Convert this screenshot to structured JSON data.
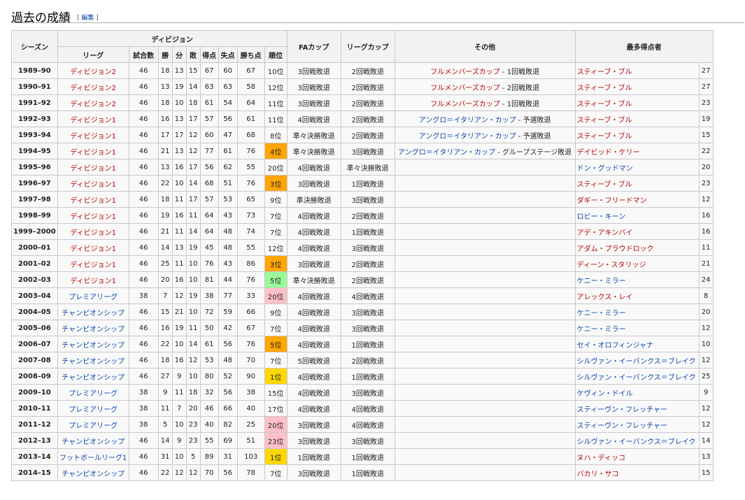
{
  "section": {
    "title": "過去の成績",
    "edit_open": "[ ",
    "edit_label": "編集",
    "edit_close": " ]"
  },
  "colors": {
    "link_blue": "#0645ad",
    "link_red": "#ba0000",
    "orange": "#ffa500",
    "gold": "#ffd700",
    "green": "#98fb98",
    "pink": "#ffc0cb"
  },
  "headers": {
    "season": "シーズン",
    "division": "ディビジョン",
    "fa_cup": "FAカップ",
    "league_cup": "リーグカップ",
    "other": "その他",
    "top_scorer": "最多得点者",
    "league": "リーグ",
    "played": "試合数",
    "won": "勝",
    "drawn": "分",
    "lost": "敗",
    "gf": "得点",
    "ga": "失点",
    "pts": "勝ち点",
    "pos": "順位"
  },
  "rows": [
    {
      "season": "1989–90",
      "league": "ディビジョン2",
      "lc": "red",
      "p": "46",
      "w": "18",
      "d": "13",
      "l": "15",
      "gf": "67",
      "ga": "60",
      "pts": "67",
      "pos": "10位",
      "pc": "",
      "fa": "3回戦敗退",
      "lcup": "2回戦敗退",
      "other": "フルメンバーズカップ",
      "oc": "red",
      "other_suffix": " - 1回戦敗退",
      "scorer": "スティーブ・ブル",
      "sc": "red",
      "goals": "27"
    },
    {
      "season": "1990–91",
      "league": "ディビジョン2",
      "lc": "red",
      "p": "46",
      "w": "13",
      "d": "19",
      "l": "14",
      "gf": "63",
      "ga": "63",
      "pts": "58",
      "pos": "12位",
      "pc": "",
      "fa": "3回戦敗退",
      "lcup": "2回戦敗退",
      "other": "フルメンバーズカップ",
      "oc": "red",
      "other_suffix": " - 2回戦敗退",
      "scorer": "スティーブ・ブル",
      "sc": "red",
      "goals": "27"
    },
    {
      "season": "1991–92",
      "league": "ディビジョン2",
      "lc": "red",
      "p": "46",
      "w": "18",
      "d": "10",
      "l": "18",
      "gf": "61",
      "ga": "54",
      "pts": "64",
      "pos": "11位",
      "pc": "",
      "fa": "3回戦敗退",
      "lcup": "2回戦敗退",
      "other": "フルメンバーズカップ",
      "oc": "red",
      "other_suffix": " - 1回戦敗退",
      "scorer": "スティーブ・ブル",
      "sc": "red",
      "goals": "23"
    },
    {
      "season": "1992–93",
      "league": "ディビジョン1",
      "lc": "red",
      "p": "46",
      "w": "16",
      "d": "13",
      "l": "17",
      "gf": "57",
      "ga": "56",
      "pts": "61",
      "pos": "11位",
      "pc": "",
      "fa": "4回戦敗退",
      "lcup": "2回戦敗退",
      "other": "アングロ＝イタリアン・カップ",
      "oc": "blue",
      "other_suffix": " - 予選敗退",
      "scorer": "スティーブ・ブル",
      "sc": "red",
      "goals": "19"
    },
    {
      "season": "1993–94",
      "league": "ディビジョン1",
      "lc": "red",
      "p": "46",
      "w": "17",
      "d": "17",
      "l": "12",
      "gf": "60",
      "ga": "47",
      "pts": "68",
      "pos": "8位",
      "pc": "",
      "fa": "準々決勝敗退",
      "lcup": "2回戦敗退",
      "other": "アングロ＝イタリアン・カップ",
      "oc": "blue",
      "other_suffix": " - 予選敗退",
      "scorer": "スティーブ・ブル",
      "sc": "red",
      "goals": "15"
    },
    {
      "season": "1994–95",
      "league": "ディビジョン1",
      "lc": "red",
      "p": "46",
      "w": "21",
      "d": "13",
      "l": "12",
      "gf": "77",
      "ga": "61",
      "pts": "76",
      "pos": "4位",
      "pc": "orange",
      "fa": "準々決勝敗退",
      "lcup": "3回戦敗退",
      "other": "アングロ＝イタリアン・カップ",
      "oc": "blue",
      "other_suffix": " - グループステージ敗退",
      "scorer": "デイビッド・ケリー",
      "sc": "red",
      "goals": "22"
    },
    {
      "season": "1995–96",
      "league": "ディビジョン1",
      "lc": "red",
      "p": "46",
      "w": "13",
      "d": "16",
      "l": "17",
      "gf": "56",
      "ga": "62",
      "pts": "55",
      "pos": "20位",
      "pc": "",
      "fa": "4回戦敗退",
      "lcup": "準々決勝敗退",
      "other": "",
      "oc": "",
      "other_suffix": "",
      "scorer": "ドン・グッドマン",
      "sc": "blue",
      "goals": "20"
    },
    {
      "season": "1996–97",
      "league": "ディビジョン1",
      "lc": "red",
      "p": "46",
      "w": "22",
      "d": "10",
      "l": "14",
      "gf": "68",
      "ga": "51",
      "pts": "76",
      "pos": "3位",
      "pc": "orange",
      "fa": "3回戦敗退",
      "lcup": "1回戦敗退",
      "other": "",
      "oc": "",
      "other_suffix": "",
      "scorer": "スティーブ・ブル",
      "sc": "red",
      "goals": "23"
    },
    {
      "season": "1997–98",
      "league": "ディビジョン1",
      "lc": "red",
      "p": "46",
      "w": "18",
      "d": "11",
      "l": "17",
      "gf": "57",
      "ga": "53",
      "pts": "65",
      "pos": "9位",
      "pc": "",
      "fa": "準決勝敗退",
      "lcup": "3回戦敗退",
      "other": "",
      "oc": "",
      "other_suffix": "",
      "scorer": "ダギー・フリードマン",
      "sc": "red",
      "goals": "12"
    },
    {
      "season": "1998–99",
      "league": "ディビジョン1",
      "lc": "red",
      "p": "46",
      "w": "19",
      "d": "16",
      "l": "11",
      "gf": "64",
      "ga": "43",
      "pts": "73",
      "pos": "7位",
      "pc": "",
      "fa": "4回戦敗退",
      "lcup": "2回戦敗退",
      "other": "",
      "oc": "",
      "other_suffix": "",
      "scorer": "ロビー・キーン",
      "sc": "blue",
      "goals": "16"
    },
    {
      "season": "1999–2000",
      "league": "ディビジョン1",
      "lc": "red",
      "p": "46",
      "w": "21",
      "d": "11",
      "l": "14",
      "gf": "64",
      "ga": "48",
      "pts": "74",
      "pos": "7位",
      "pc": "",
      "fa": "4回戦敗退",
      "lcup": "1回戦敗退",
      "other": "",
      "oc": "",
      "other_suffix": "",
      "scorer": "アデ・アキンバイ",
      "sc": "red",
      "goals": "16"
    },
    {
      "season": "2000–01",
      "league": "ディビジョン1",
      "lc": "red",
      "p": "46",
      "w": "14",
      "d": "13",
      "l": "19",
      "gf": "45",
      "ga": "48",
      "pts": "55",
      "pos": "12位",
      "pc": "",
      "fa": "4回戦敗退",
      "lcup": "3回戦敗退",
      "other": "",
      "oc": "",
      "other_suffix": "",
      "scorer": "アダム・プラウドロック",
      "sc": "red",
      "goals": "11"
    },
    {
      "season": "2001–02",
      "league": "ディビジョン1",
      "lc": "red",
      "p": "46",
      "w": "25",
      "d": "11",
      "l": "10",
      "gf": "76",
      "ga": "43",
      "pts": "86",
      "pos": "3位",
      "pc": "orange",
      "fa": "3回戦敗退",
      "lcup": "2回戦敗退",
      "other": "",
      "oc": "",
      "other_suffix": "",
      "scorer": "ディーン・スタリッジ",
      "sc": "red",
      "goals": "21"
    },
    {
      "season": "2002–03",
      "league": "ディビジョン1",
      "lc": "red",
      "p": "46",
      "w": "20",
      "d": "16",
      "l": "10",
      "gf": "81",
      "ga": "44",
      "pts": "76",
      "pos": "5位",
      "pc": "green",
      "fa": "準々決勝敗退",
      "lcup": "2回戦敗退",
      "other": "",
      "oc": "",
      "other_suffix": "",
      "scorer": "ケニー・ミラー",
      "sc": "blue",
      "goals": "24"
    },
    {
      "season": "2003–04",
      "league": "プレミアリーグ",
      "lc": "blue",
      "p": "38",
      "w": "7",
      "d": "12",
      "l": "19",
      "gf": "38",
      "ga": "77",
      "pts": "33",
      "pos": "20位",
      "pc": "pink",
      "fa": "4回戦敗退",
      "lcup": "4回戦敗退",
      "other": "",
      "oc": "",
      "other_suffix": "",
      "scorer": "アレックス・レイ",
      "sc": "red",
      "goals": "8"
    },
    {
      "season": "2004–05",
      "league": "チャンピオンシップ",
      "lc": "blue",
      "p": "46",
      "w": "15",
      "d": "21",
      "l": "10",
      "gf": "72",
      "ga": "59",
      "pts": "66",
      "pos": "9位",
      "pc": "",
      "fa": "4回戦敗退",
      "lcup": "3回戦敗退",
      "other": "",
      "oc": "",
      "other_suffix": "",
      "scorer": "ケニー・ミラー",
      "sc": "blue",
      "goals": "20"
    },
    {
      "season": "2005–06",
      "league": "チャンピオンシップ",
      "lc": "blue",
      "p": "46",
      "w": "16",
      "d": "19",
      "l": "11",
      "gf": "50",
      "ga": "42",
      "pts": "67",
      "pos": "7位",
      "pc": "",
      "fa": "4回戦敗退",
      "lcup": "3回戦敗退",
      "other": "",
      "oc": "",
      "other_suffix": "",
      "scorer": "ケニー・ミラー",
      "sc": "blue",
      "goals": "12"
    },
    {
      "season": "2006–07",
      "league": "チャンピオンシップ",
      "lc": "blue",
      "p": "46",
      "w": "22",
      "d": "10",
      "l": "14",
      "gf": "61",
      "ga": "56",
      "pts": "76",
      "pos": "5位",
      "pc": "orange",
      "fa": "4回戦敗退",
      "lcup": "1回戦敗退",
      "other": "",
      "oc": "",
      "other_suffix": "",
      "scorer": "セイ・オロフィンジャナ",
      "sc": "blue",
      "goals": "10"
    },
    {
      "season": "2007–08",
      "league": "チャンピオンシップ",
      "lc": "blue",
      "p": "46",
      "w": "18",
      "d": "16",
      "l": "12",
      "gf": "53",
      "ga": "48",
      "pts": "70",
      "pos": "7位",
      "pc": "",
      "fa": "5回戦敗退",
      "lcup": "2回戦敗退",
      "other": "",
      "oc": "",
      "other_suffix": "",
      "scorer": "シルヴァン・イーバンクス＝ブレイク",
      "sc": "blue",
      "goals": "12"
    },
    {
      "season": "2008–09",
      "league": "チャンピオンシップ",
      "lc": "blue",
      "p": "46",
      "w": "27",
      "d": "9",
      "l": "10",
      "gf": "80",
      "ga": "52",
      "pts": "90",
      "pos": "1位",
      "pc": "gold",
      "fa": "4回戦敗退",
      "lcup": "1回戦敗退",
      "other": "",
      "oc": "",
      "other_suffix": "",
      "scorer": "シルヴァン・イーバンクス＝ブレイク",
      "sc": "blue",
      "goals": "25"
    },
    {
      "season": "2009–10",
      "league": "プレミアリーグ",
      "lc": "blue",
      "p": "38",
      "w": "9",
      "d": "11",
      "l": "18",
      "gf": "32",
      "ga": "56",
      "pts": "38",
      "pos": "15位",
      "pc": "",
      "fa": "4回戦敗退",
      "lcup": "3回戦敗退",
      "other": "",
      "oc": "",
      "other_suffix": "",
      "scorer": "ケヴィン・ドイル",
      "sc": "blue",
      "goals": "9"
    },
    {
      "season": "2010–11",
      "league": "プレミアリーグ",
      "lc": "blue",
      "p": "38",
      "w": "11",
      "d": "7",
      "l": "20",
      "gf": "46",
      "ga": "66",
      "pts": "40",
      "pos": "17位",
      "pc": "",
      "fa": "4回戦敗退",
      "lcup": "4回戦敗退",
      "other": "",
      "oc": "",
      "other_suffix": "",
      "scorer": "スティーヴン・フレッチャー",
      "sc": "blue",
      "goals": "12"
    },
    {
      "season": "2011–12",
      "league": "プレミアリーグ",
      "lc": "blue",
      "p": "38",
      "w": "5",
      "d": "10",
      "l": "23",
      "gf": "40",
      "ga": "82",
      "pts": "25",
      "pos": "20位",
      "pc": "pink",
      "fa": "3回戦敗退",
      "lcup": "4回戦敗退",
      "other": "",
      "oc": "",
      "other_suffix": "",
      "scorer": "スティーヴン・フレッチャー",
      "sc": "blue",
      "goals": "12"
    },
    {
      "season": "2012–13",
      "league": "チャンピオンシップ",
      "lc": "blue",
      "p": "46",
      "w": "14",
      "d": "9",
      "l": "23",
      "gf": "55",
      "ga": "69",
      "pts": "51",
      "pos": "23位",
      "pc": "pink",
      "fa": "3回戦敗退",
      "lcup": "3回戦敗退",
      "other": "",
      "oc": "",
      "other_suffix": "",
      "scorer": "シルヴァン・イーバンクス＝ブレイク",
      "sc": "blue",
      "goals": "14"
    },
    {
      "season": "2013–14",
      "league": "フットボールリーグ1",
      "lc": "blue",
      "p": "46",
      "w": "31",
      "d": "10",
      "l": "5",
      "gf": "89",
      "ga": "31",
      "pts": "103",
      "pos": "1位",
      "pc": "gold",
      "fa": "1回戦敗退",
      "lcup": "1回戦敗退",
      "other": "",
      "oc": "",
      "other_suffix": "",
      "scorer": "ヌハ・ディッコ",
      "sc": "red",
      "goals": "13"
    },
    {
      "season": "2014–15",
      "league": "チャンピオンシップ",
      "lc": "blue",
      "p": "46",
      "w": "22",
      "d": "12",
      "l": "12",
      "gf": "70",
      "ga": "56",
      "pts": "78",
      "pos": "7位",
      "pc": "",
      "fa": "3回戦敗退",
      "lcup": "1回戦敗退",
      "other": "",
      "oc": "",
      "other_suffix": "",
      "scorer": "バカリ・サコ",
      "sc": "red",
      "goals": "15"
    }
  ]
}
